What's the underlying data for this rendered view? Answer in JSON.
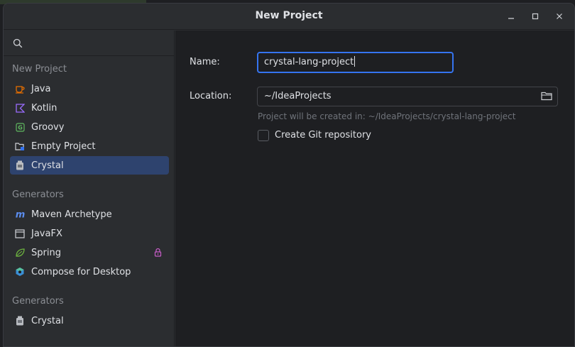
{
  "window": {
    "title": "New Project"
  },
  "sidebar": {
    "groups": [
      {
        "label": "New Project"
      },
      {
        "label": "Generators"
      },
      {
        "label": "Generators"
      }
    ],
    "new_project_items": [
      {
        "label": "Java",
        "icon": "java-cup-icon"
      },
      {
        "label": "Kotlin",
        "icon": "kotlin-icon"
      },
      {
        "label": "Groovy",
        "icon": "groovy-icon"
      },
      {
        "label": "Empty Project",
        "icon": "empty-project-icon"
      },
      {
        "label": "Crystal",
        "icon": "crystal-jar-icon",
        "selected": true
      }
    ],
    "generator_items": [
      {
        "label": "Maven Archetype",
        "icon": "maven-icon"
      },
      {
        "label": "JavaFX",
        "icon": "javafx-window-icon"
      },
      {
        "label": "Spring",
        "icon": "spring-leaf-icon",
        "locked": true
      },
      {
        "label": "Compose for Desktop",
        "icon": "compose-icon"
      }
    ],
    "generator_items_2": [
      {
        "label": "Crystal",
        "icon": "crystal-jar-icon"
      }
    ]
  },
  "form": {
    "name_label": "Name:",
    "name_value": "crystal-lang-project",
    "location_label": "Location:",
    "location_value": "~/IdeaProjects",
    "hint": "Project will be created in: ~/IdeaProjects/crystal-lang-project",
    "git_label": "Create Git repository",
    "git_checked": false
  },
  "colors": {
    "accent": "#3574f0",
    "selection": "#2e436e",
    "java": "#e76f00",
    "kotlin": "#9b6dff",
    "groovy": "#5fb85f",
    "spring": "#6db33f",
    "lock": "#c85dc8",
    "maven": "#5b8def"
  }
}
